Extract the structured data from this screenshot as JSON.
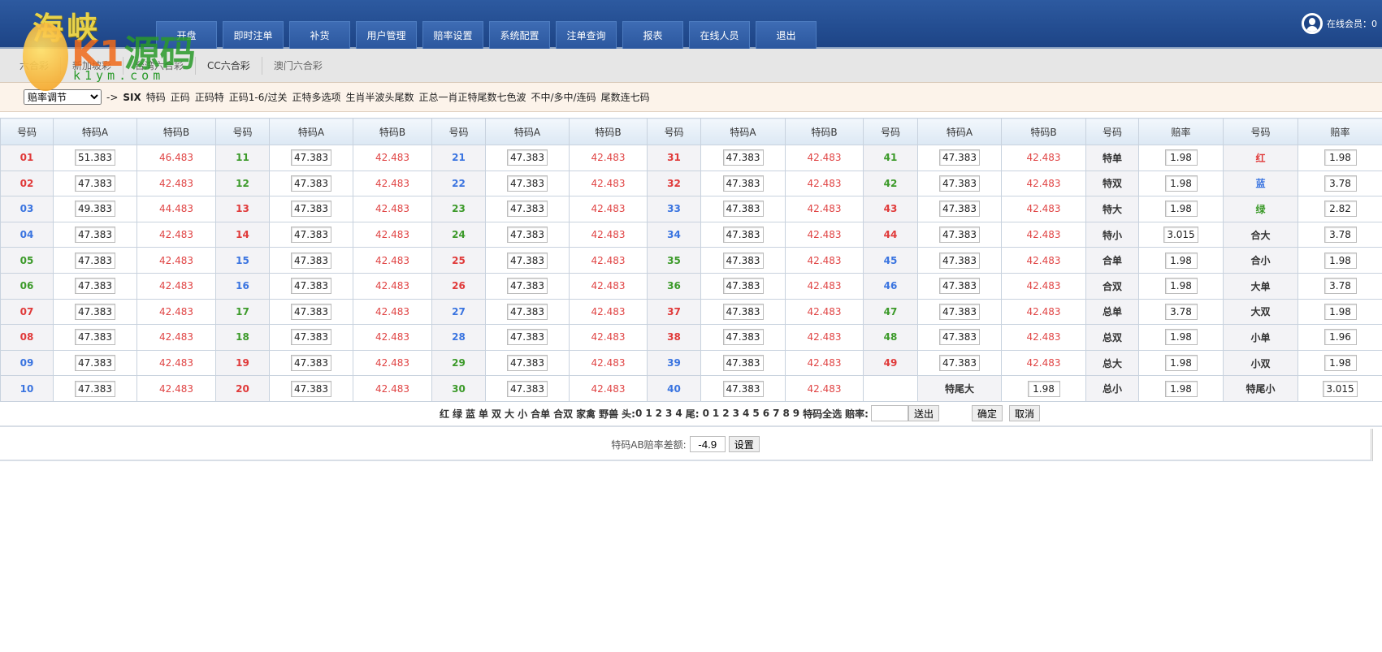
{
  "header": {
    "logo": "海峡",
    "online_label": "在线会员：0",
    "nav": [
      "开盘",
      "即时注单",
      "补货",
      "用户管理",
      "赔率设置",
      "系统配置",
      "注单查询",
      "报表",
      "在线人员",
      "退出"
    ]
  },
  "watermark": {
    "brand": "K1",
    "brand_cn": "源码",
    "url": "k1ym.com"
  },
  "subnav": [
    "六合彩",
    "新加坡彩",
    "台湾六合彩",
    "CC六合彩",
    "澳门六合彩"
  ],
  "filter": {
    "select_value": "赔率调节",
    "arrow": "->",
    "game": "SIX",
    "links": [
      "特码",
      "正码",
      "正码特",
      "正码1-6/过关",
      "正特多选项",
      "生肖半波头尾数",
      "正总一肖正特尾数七色波",
      "不中/多中/连码",
      "尾数连七码"
    ]
  },
  "table": {
    "headers": [
      "号码",
      "特码A",
      "特码B",
      "号码",
      "特码A",
      "特码B",
      "号码",
      "特码A",
      "特码B",
      "号码",
      "特码A",
      "特码B",
      "号码",
      "特码A",
      "特码B",
      "号码",
      "赔率",
      "号码",
      "赔率"
    ],
    "colors": {
      "red": "#e03a3a",
      "blue": "#3a74e0",
      "green": "#3c9a2a"
    },
    "numbers": [
      {
        "no": "01",
        "a": "51.383",
        "b": "46.483",
        "color": "red"
      },
      {
        "no": "02",
        "a": "47.383",
        "b": "42.483",
        "color": "red"
      },
      {
        "no": "03",
        "a": "49.383",
        "b": "44.483",
        "color": "blue"
      },
      {
        "no": "04",
        "a": "47.383",
        "b": "42.483",
        "color": "blue"
      },
      {
        "no": "05",
        "a": "47.383",
        "b": "42.483",
        "color": "green"
      },
      {
        "no": "06",
        "a": "47.383",
        "b": "42.483",
        "color": "green"
      },
      {
        "no": "07",
        "a": "47.383",
        "b": "42.483",
        "color": "red"
      },
      {
        "no": "08",
        "a": "47.383",
        "b": "42.483",
        "color": "red"
      },
      {
        "no": "09",
        "a": "47.383",
        "b": "42.483",
        "color": "blue"
      },
      {
        "no": "10",
        "a": "47.383",
        "b": "42.483",
        "color": "blue"
      },
      {
        "no": "11",
        "a": "47.383",
        "b": "42.483",
        "color": "green"
      },
      {
        "no": "12",
        "a": "47.383",
        "b": "42.483",
        "color": "green"
      },
      {
        "no": "13",
        "a": "47.383",
        "b": "42.483",
        "color": "red"
      },
      {
        "no": "14",
        "a": "47.383",
        "b": "42.483",
        "color": "red"
      },
      {
        "no": "15",
        "a": "47.383",
        "b": "42.483",
        "color": "blue"
      },
      {
        "no": "16",
        "a": "47.383",
        "b": "42.483",
        "color": "blue"
      },
      {
        "no": "17",
        "a": "47.383",
        "b": "42.483",
        "color": "green"
      },
      {
        "no": "18",
        "a": "47.383",
        "b": "42.483",
        "color": "green"
      },
      {
        "no": "19",
        "a": "47.383",
        "b": "42.483",
        "color": "red"
      },
      {
        "no": "20",
        "a": "47.383",
        "b": "42.483",
        "color": "red"
      },
      {
        "no": "21",
        "a": "47.383",
        "b": "42.483",
        "color": "blue"
      },
      {
        "no": "22",
        "a": "47.383",
        "b": "42.483",
        "color": "blue"
      },
      {
        "no": "23",
        "a": "47.383",
        "b": "42.483",
        "color": "green"
      },
      {
        "no": "24",
        "a": "47.383",
        "b": "42.483",
        "color": "green"
      },
      {
        "no": "25",
        "a": "47.383",
        "b": "42.483",
        "color": "red"
      },
      {
        "no": "26",
        "a": "47.383",
        "b": "42.483",
        "color": "red"
      },
      {
        "no": "27",
        "a": "47.383",
        "b": "42.483",
        "color": "blue"
      },
      {
        "no": "28",
        "a": "47.383",
        "b": "42.483",
        "color": "blue"
      },
      {
        "no": "29",
        "a": "47.383",
        "b": "42.483",
        "color": "green"
      },
      {
        "no": "30",
        "a": "47.383",
        "b": "42.483",
        "color": "green"
      },
      {
        "no": "31",
        "a": "47.383",
        "b": "42.483",
        "color": "red"
      },
      {
        "no": "32",
        "a": "47.383",
        "b": "42.483",
        "color": "red"
      },
      {
        "no": "33",
        "a": "47.383",
        "b": "42.483",
        "color": "blue"
      },
      {
        "no": "34",
        "a": "47.383",
        "b": "42.483",
        "color": "blue"
      },
      {
        "no": "35",
        "a": "47.383",
        "b": "42.483",
        "color": "green"
      },
      {
        "no": "36",
        "a": "47.383",
        "b": "42.483",
        "color": "green"
      },
      {
        "no": "37",
        "a": "47.383",
        "b": "42.483",
        "color": "red"
      },
      {
        "no": "38",
        "a": "47.383",
        "b": "42.483",
        "color": "red"
      },
      {
        "no": "39",
        "a": "47.383",
        "b": "42.483",
        "color": "blue"
      },
      {
        "no": "40",
        "a": "47.383",
        "b": "42.483",
        "color": "blue"
      },
      {
        "no": "41",
        "a": "47.383",
        "b": "42.483",
        "color": "green"
      },
      {
        "no": "42",
        "a": "47.383",
        "b": "42.483",
        "color": "green"
      },
      {
        "no": "43",
        "a": "47.383",
        "b": "42.483",
        "color": "red"
      },
      {
        "no": "44",
        "a": "47.383",
        "b": "42.483",
        "color": "red"
      },
      {
        "no": "45",
        "a": "47.383",
        "b": "42.483",
        "color": "blue"
      },
      {
        "no": "46",
        "a": "47.383",
        "b": "42.483",
        "color": "blue"
      },
      {
        "no": "47",
        "a": "47.383",
        "b": "42.483",
        "color": "green"
      },
      {
        "no": "48",
        "a": "47.383",
        "b": "42.483",
        "color": "green"
      },
      {
        "no": "49",
        "a": "47.383",
        "b": "42.483",
        "color": "red"
      }
    ],
    "extra": {
      "label": "特尾大",
      "odds": "1.98"
    },
    "side1": [
      {
        "label": "特单",
        "odds": "1.98"
      },
      {
        "label": "特双",
        "odds": "1.98"
      },
      {
        "label": "特大",
        "odds": "1.98"
      },
      {
        "label": "特小",
        "odds": "3.015"
      },
      {
        "label": "合单",
        "odds": "1.98"
      },
      {
        "label": "合双",
        "odds": "1.98"
      },
      {
        "label": "总单",
        "odds": "3.78"
      },
      {
        "label": "总双",
        "odds": "1.98"
      },
      {
        "label": "总大",
        "odds": "1.98"
      },
      {
        "label": "总小",
        "odds": "1.98"
      }
    ],
    "side2": [
      {
        "label": "红",
        "odds": "1.98",
        "color": "red"
      },
      {
        "label": "蓝",
        "odds": "3.78",
        "color": "blue"
      },
      {
        "label": "绿",
        "odds": "2.82",
        "color": "green"
      },
      {
        "label": "合大",
        "odds": "3.78"
      },
      {
        "label": "合小",
        "odds": "1.98"
      },
      {
        "label": "大单",
        "odds": "3.78"
      },
      {
        "label": "大双",
        "odds": "1.98"
      },
      {
        "label": "小单",
        "odds": "1.96"
      },
      {
        "label": "小双",
        "odds": "1.98"
      },
      {
        "label": "特尾小",
        "odds": "3.015"
      }
    ]
  },
  "tools": {
    "quick": [
      "红",
      "绿",
      "蓝",
      "单",
      "双",
      "大",
      "小",
      "合单",
      "合双",
      "家禽",
      "野兽"
    ],
    "head_label": "头:",
    "heads": [
      "0",
      "1",
      "2",
      "3",
      "4"
    ],
    "tail_label": "尾:",
    "tails": [
      "0",
      "1",
      "2",
      "3",
      "4",
      "5",
      "6",
      "7",
      "8",
      "9"
    ],
    "select_all": "特码全选",
    "odds_label": "赔率:",
    "odds_value": "",
    "send": "送出",
    "confirm": "确定",
    "cancel": "取消"
  },
  "diff": {
    "label": "特码AB赔率差额:",
    "value": "-4.9",
    "set": "设置"
  }
}
